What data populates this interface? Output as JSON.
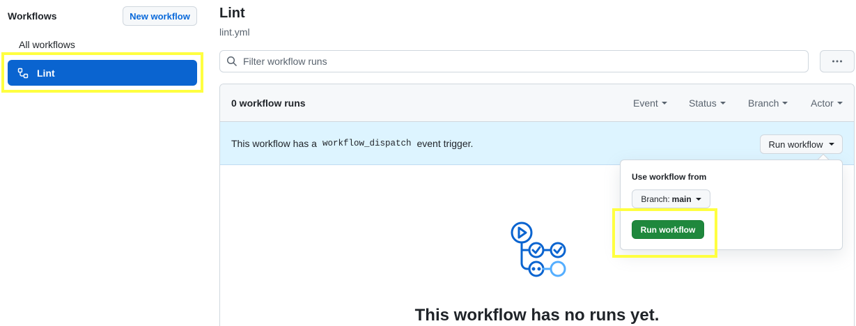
{
  "sidebar": {
    "title": "Workflows",
    "new_workflow_label": "New workflow",
    "all_workflows_label": "All workflows",
    "items": [
      {
        "label": "Lint",
        "icon": "workflow-icon",
        "selected": true
      }
    ]
  },
  "header": {
    "title": "Lint",
    "filename": "lint.yml"
  },
  "search": {
    "placeholder": "Filter workflow runs",
    "value": ""
  },
  "runs": {
    "count_label": "0 workflow runs",
    "filters": [
      "Event",
      "Status",
      "Branch",
      "Actor"
    ]
  },
  "banner": {
    "text_before": "This workflow has a",
    "code": "workflow_dispatch",
    "text_after": "event trigger.",
    "run_button_label": "Run workflow"
  },
  "dropdown": {
    "label": "Use workflow from",
    "branch_prefix": "Branch:",
    "branch_value": "main",
    "run_button_label": "Run workflow"
  },
  "empty_state": {
    "title": "This workflow has no runs yet."
  },
  "colors": {
    "accent": "#0969da",
    "selected_bg": "#0a64d0",
    "banner_bg": "#ddf4ff",
    "run_green": "#1f883d",
    "highlight": "#ffff40"
  }
}
